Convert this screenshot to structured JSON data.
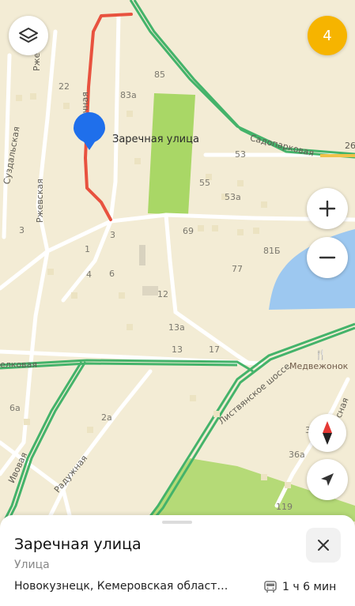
{
  "map": {
    "streets": {
      "rzhevskaya_top": "Ржевская",
      "rzhevskaya_left": "Ржевская",
      "suzdalskaya": "Суздальская",
      "red_street_fragment": "ечная",
      "sadoparkovaya": "Садопарковая",
      "elkovaya": "елковая",
      "listvyanskoe": "Листвянское шоссе",
      "ivovaya": "Ивовая",
      "raduzhnaya": "Радужная",
      "lesnaya": "Лесная",
      "edge_number": "26"
    },
    "house_numbers": [
      "22",
      "85",
      "83а",
      "53",
      "55",
      "53а",
      "3",
      "3",
      "69",
      "81Б",
      "1",
      "4",
      "6",
      "77",
      "12",
      "13а",
      "13",
      "17",
      "6а",
      "2а",
      "3",
      "36а",
      "119"
    ],
    "pin_label": "Заречная улица",
    "poi_name": "Медвежонок",
    "colors": {
      "route_red": "#e8523f",
      "road_green": "#44b36a",
      "park_green": "#a9d766",
      "water": "#9dc8f0",
      "pin_blue": "#1f6feb",
      "badge_yellow": "#f6b400"
    }
  },
  "controls": {
    "layers": "layers-icon",
    "badge": "4",
    "zoom_in": "plus-icon",
    "zoom_out": "minus-icon",
    "compass": "compass-icon",
    "location": "location-arrow-icon"
  },
  "sheet": {
    "title": "Заречная улица",
    "subtitle": "Улица",
    "address": "Новокузнецк, Кемеровская област…",
    "route_time": "1 ч 6 мин",
    "close": "close-icon"
  }
}
